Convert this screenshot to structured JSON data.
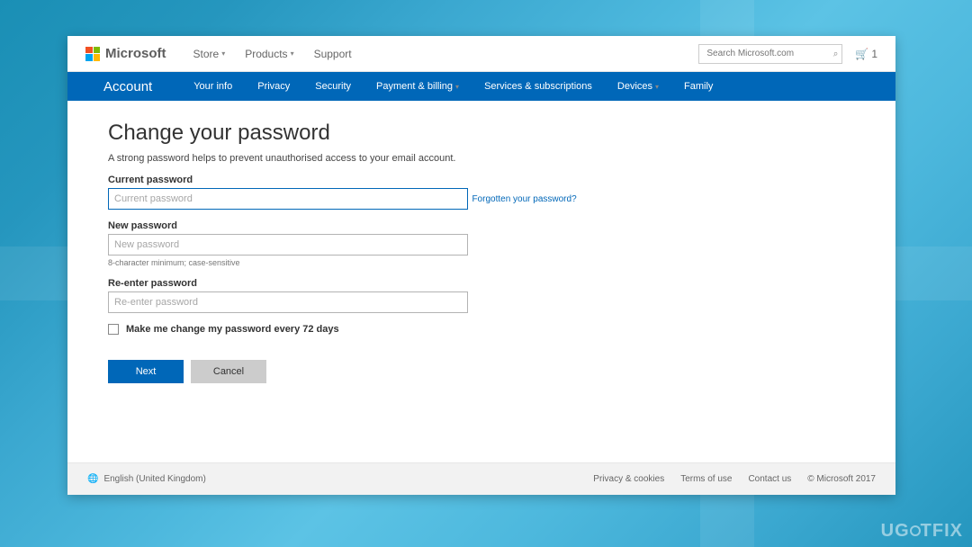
{
  "brand": "Microsoft",
  "top_menu": {
    "store": "Store",
    "products": "Products",
    "support": "Support"
  },
  "search": {
    "placeholder": "Search Microsoft.com"
  },
  "cart_count": "1",
  "bluebar": {
    "account": "Account",
    "your_info": "Your info",
    "privacy": "Privacy",
    "security": "Security",
    "payment": "Payment & billing",
    "services": "Services & subscriptions",
    "devices": "Devices",
    "family": "Family"
  },
  "page": {
    "title": "Change your password",
    "subtitle": "A strong password helps to prevent unauthorised access to your email account.",
    "current_label": "Current password",
    "current_placeholder": "Current password",
    "forgot_link": "Forgotten your password?",
    "new_label": "New password",
    "new_placeholder": "New password",
    "new_hint": "8-character minimum; case-sensitive",
    "re_label": "Re-enter password",
    "re_placeholder": "Re-enter password",
    "checkbox_label": "Make me change my password every 72 days",
    "next": "Next",
    "cancel": "Cancel"
  },
  "footer": {
    "locale": "English (United Kingdom)",
    "privacy": "Privacy & cookies",
    "terms": "Terms of use",
    "contact": "Contact us",
    "copyright": "© Microsoft 2017"
  },
  "watermark": "UGETFIX"
}
